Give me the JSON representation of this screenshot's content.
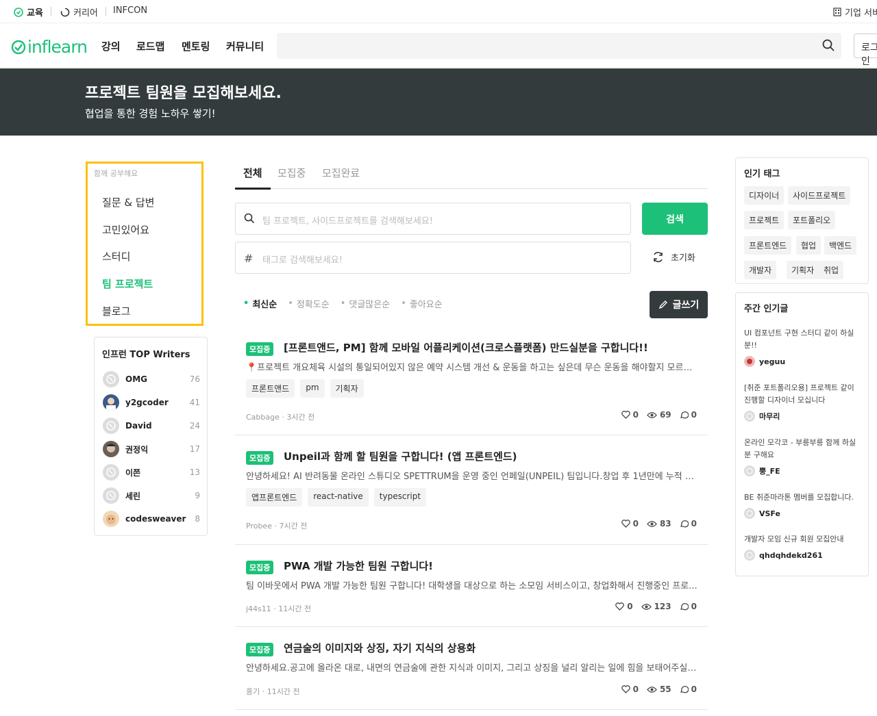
{
  "topbar": {
    "edu": "교육",
    "career": "커리어",
    "infcon": "INFCON",
    "business": "기업 서비스"
  },
  "header": {
    "logo": "inflearn",
    "nav": [
      "강의",
      "로드맵",
      "멘토링",
      "커뮤니티"
    ],
    "login": "로그인"
  },
  "banner": {
    "title": "프로젝트 팀원을 모집해보세요.",
    "subtitle": "협업을 통한 경험 노하우 쌓기!"
  },
  "sidenav": {
    "head": "함께 공부해요",
    "items": [
      "질문 & 답변",
      "고민있어요",
      "스터디",
      "팀 프로젝트",
      "블로그"
    ],
    "active_index": 3
  },
  "writers": {
    "title": "인프런 TOP Writers",
    "rows": [
      {
        "name": "OMG",
        "count": "76"
      },
      {
        "name": "y2gcoder",
        "count": "41"
      },
      {
        "name": "David",
        "count": "24"
      },
      {
        "name": "권정익",
        "count": "17"
      },
      {
        "name": "이쯘",
        "count": "13"
      },
      {
        "name": "세린",
        "count": "9"
      },
      {
        "name": "codesweaver",
        "count": "8"
      }
    ]
  },
  "tabs": [
    "전체",
    "모집중",
    "모집완료"
  ],
  "search": {
    "placeholder": "팀 프로젝트, 사이드프로젝트를 검색해보세요!",
    "button": "검색"
  },
  "tagsearch": {
    "placeholder": "태그로 검색해보세요!",
    "reset": "초기화"
  },
  "sorts": [
    "최신순",
    "정확도순",
    "댓글많은순",
    "좋아요순"
  ],
  "write": "글쓰기",
  "posts": [
    {
      "badge": "모집중",
      "title": "[프론트앤드, PM] 함께 모바일 어플리케이션(크로스플랫폼) 만드실분을 구합니다!!",
      "excerpt": "📍프로젝트 개요체육 시설의 통일되어있지 않은 예약 시스템 개선 & 운동을 하고는 싶은데 무슨 운동을 해야할지 모르겠...",
      "tags": [
        "프론트앤드",
        "pm",
        "기획자"
      ],
      "meta": "Cabbage · 3시간 전",
      "likes": "0",
      "views": "69",
      "comments": "0"
    },
    {
      "badge": "모집중",
      "title": "Unpeil과 함께 할 팀원을 구합니다! (앱 프론트엔드)",
      "excerpt": "안녕하세요! AI 반려동물 온라인 스튜디오 SPETTRUM을 운영 중인 언페일(UNPEIL) 팀입니다.창업 후 1년만에 누적 지...",
      "tags": [
        "앱프론트엔드",
        "react-native",
        "typescript"
      ],
      "meta": "Probee · 7시간 전",
      "likes": "0",
      "views": "83",
      "comments": "0"
    },
    {
      "badge": "모집중",
      "title": "PWA 개발 가능한 팀원 구합니다!",
      "excerpt": "팀 이바웃에서 PWA 개발 가능한 팀원 구합니다! 대학생을 대상으로 하는 소모임 서비스이고, 창업화해서 진행중인 프로...",
      "tags": [],
      "meta": "j44s11 · 11시간 전",
      "likes": "0",
      "views": "123",
      "comments": "0"
    },
    {
      "badge": "모집중",
      "title": "연금술의 이미지와 상징, 자기 지식의 상용화",
      "excerpt": "안녕하세요.공고에 올라온 대로, 내면의 연금술에 관한 지식과 이미지, 그리고 상징을 널리 알리는 일에 힘을 보태어주실 ...",
      "tags": [],
      "meta": "흥기 · 11시간 전",
      "likes": "0",
      "views": "55",
      "comments": "0"
    }
  ],
  "popular_tags": {
    "title": "인기 태그",
    "tags": [
      "디자이너",
      "사이드프로젝트",
      "프로젝트",
      "포트폴리오",
      "프론트엔드",
      "협업",
      "백엔드",
      "개발자",
      "기획자",
      "취업"
    ]
  },
  "weekly": {
    "title": "주간 인기글",
    "items": [
      {
        "title": "UI 컴포넌트 구현 스터디 같이 하실 분!!",
        "user": "yeguu"
      },
      {
        "title": "[취준 포트폴리오용] 프로젝트 같이 진행할 디자이너 모십니다",
        "user": "마무리"
      },
      {
        "title": "온라인 모각코 - 부릉부릉 함께 하실 분 구해요",
        "user": "뿡_FE"
      },
      {
        "title": "BE 취준마라톤 멤버를 모집합니다.",
        "user": "VSFe"
      },
      {
        "title": "개발자 모임 신규 회원 모집안내",
        "user": "qhdqhdekd261"
      }
    ]
  },
  "colors": {
    "brand": "#1dc078",
    "banner": "#333b3d",
    "highlight": "#fcc00a"
  }
}
